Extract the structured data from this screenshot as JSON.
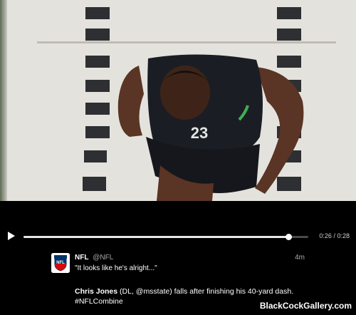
{
  "player": {
    "current_time": "0:26",
    "duration": "0:28",
    "time_separator": " / ",
    "progress": 0.93
  },
  "tweet": {
    "name": "NFL",
    "handle": "@NFL",
    "time_ago": "4m",
    "quote": "\"It looks like he's alright...\"",
    "body_bold": "Chris Jones",
    "body_rest": " (DL, @msstate) falls after finishing his 40-yard dash. #NFLCombine"
  },
  "video": {
    "jersey_number": "23"
  },
  "watermark": "BlackCockGallery.com",
  "colors": {
    "background": "#000000",
    "turf": "#e4e2dd",
    "progress_fill": "#e6e6e6",
    "nfl_blue": "#013369",
    "nfl_red": "#d50a0a"
  },
  "icons": [
    "play-icon",
    "nfl-logo-icon"
  ]
}
